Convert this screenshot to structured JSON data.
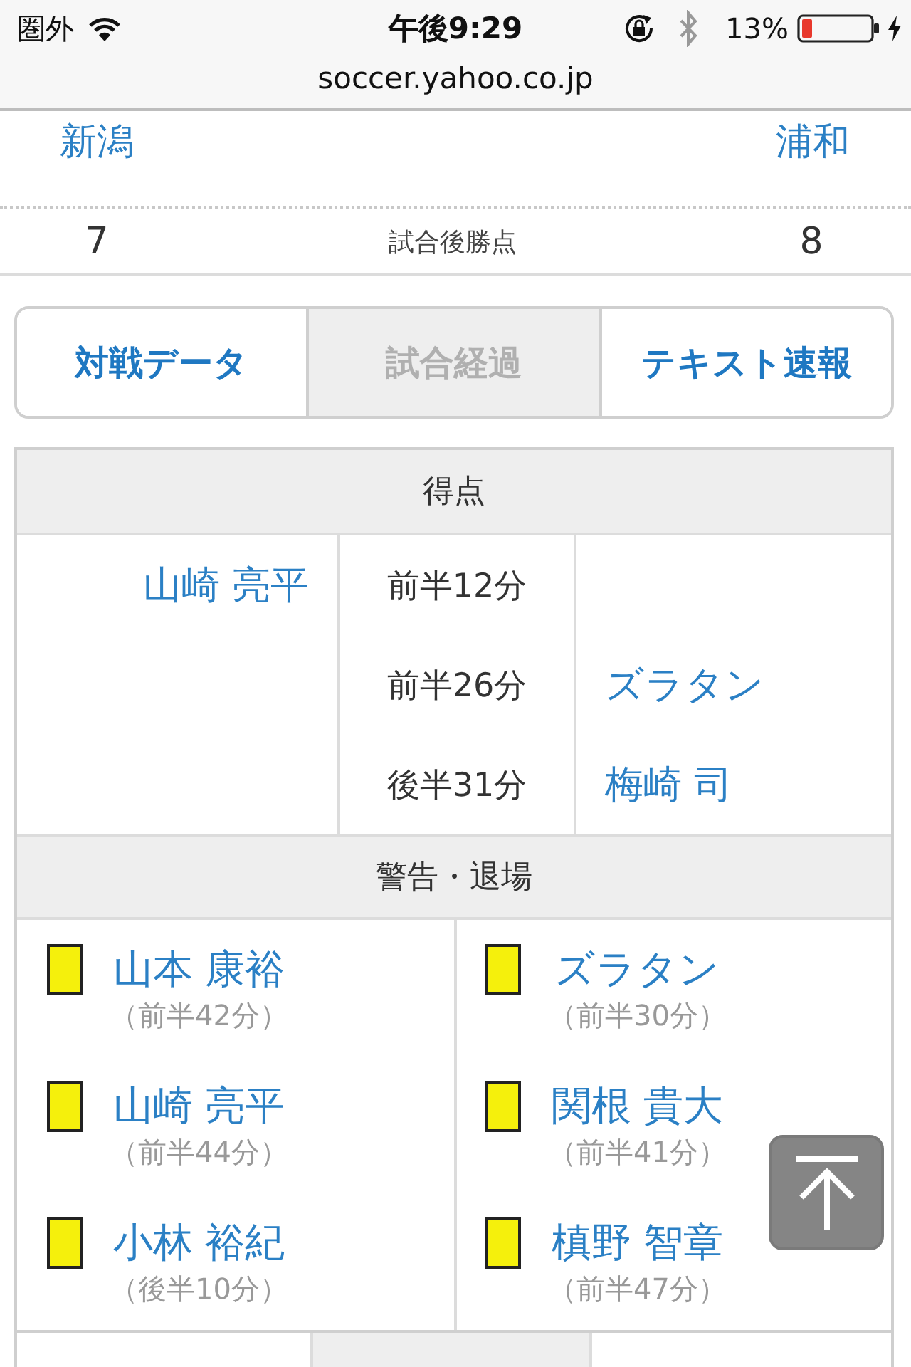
{
  "status_bar": {
    "carrier": "圏外",
    "time": "午後9:29",
    "battery": "13%"
  },
  "address_bar": {
    "url": "soccer.yahoo.co.jp"
  },
  "match": {
    "home_team": "新潟",
    "away_team": "浦和",
    "home_points": "7",
    "points_label": "試合後勝点",
    "away_points": "8"
  },
  "tabs": [
    {
      "label": "対戦データ",
      "selected": false
    },
    {
      "label": "試合経過",
      "selected": true
    },
    {
      "label": "テキスト速報",
      "selected": false
    }
  ],
  "goals": {
    "title": "得点",
    "rows": [
      {
        "home": "山崎 亮平",
        "time": "前半12分"
      },
      {
        "time": "前半26分",
        "away": "ズラタン"
      },
      {
        "time": "後半31分",
        "away": "梅崎 司"
      }
    ]
  },
  "cautions": {
    "title": "警告・退場",
    "home": [
      {
        "player": "山本 康裕",
        "time": "（前半42分）"
      },
      {
        "player": "山崎 亮平",
        "time": "（前半44分）"
      },
      {
        "player": "小林 裕紀",
        "time": "（後半10分）"
      }
    ],
    "away": [
      {
        "player": "ズラタン",
        "time": "（前半30分）"
      },
      {
        "player": "関根 貴大",
        "time": "（前半41分）"
      },
      {
        "player": "槙野 智章",
        "time": "（前半47分）"
      }
    ]
  }
}
